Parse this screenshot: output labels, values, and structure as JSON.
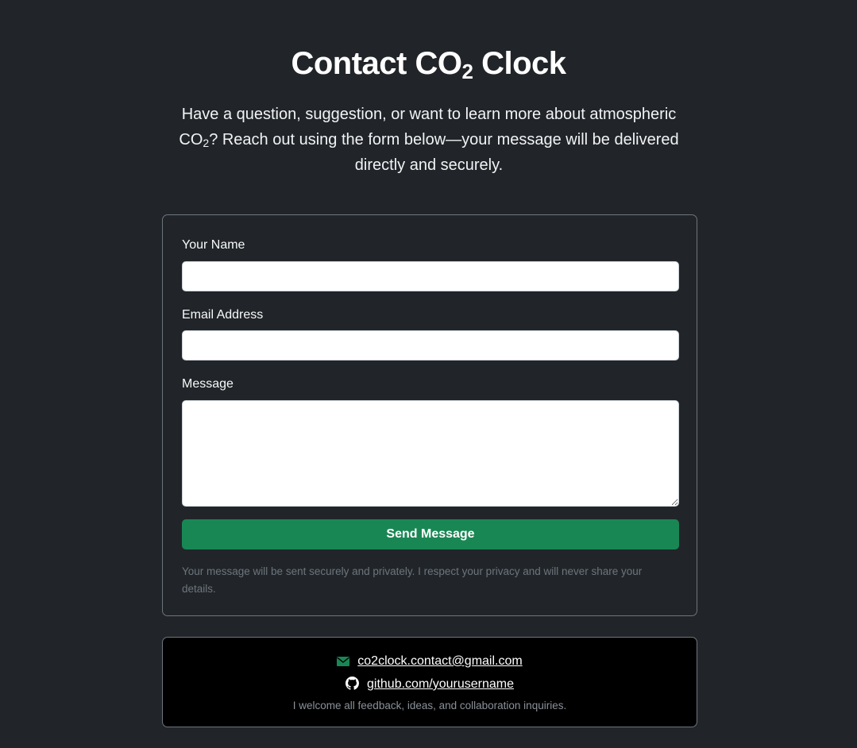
{
  "header": {
    "title_main": "Contact CO",
    "title_sub": "2",
    "title_end": " Clock",
    "intro_a": "Have a question, suggestion, or want to learn more about atmospheric CO",
    "intro_sub": "2",
    "intro_b": "? Reach out using the form below—your message will be delivered directly and securely."
  },
  "form": {
    "name_label": "Your Name",
    "name_value": "",
    "email_label": "Email Address",
    "email_value": "",
    "message_label": "Message",
    "message_value": "",
    "submit_label": "Send Message",
    "privacy_note": "Your message will be sent securely and privately. I respect your privacy and will never share your details."
  },
  "contact": {
    "email": "co2clock.contact@gmail.com",
    "email_icon": "envelope-icon",
    "github": "github.com/yourusername",
    "github_icon": "github-icon",
    "welcome": "I welcome all feedback, ideas, and collaboration inquiries."
  },
  "colors": {
    "background": "#212529",
    "accent": "#198754",
    "card_bg": "#000000"
  }
}
